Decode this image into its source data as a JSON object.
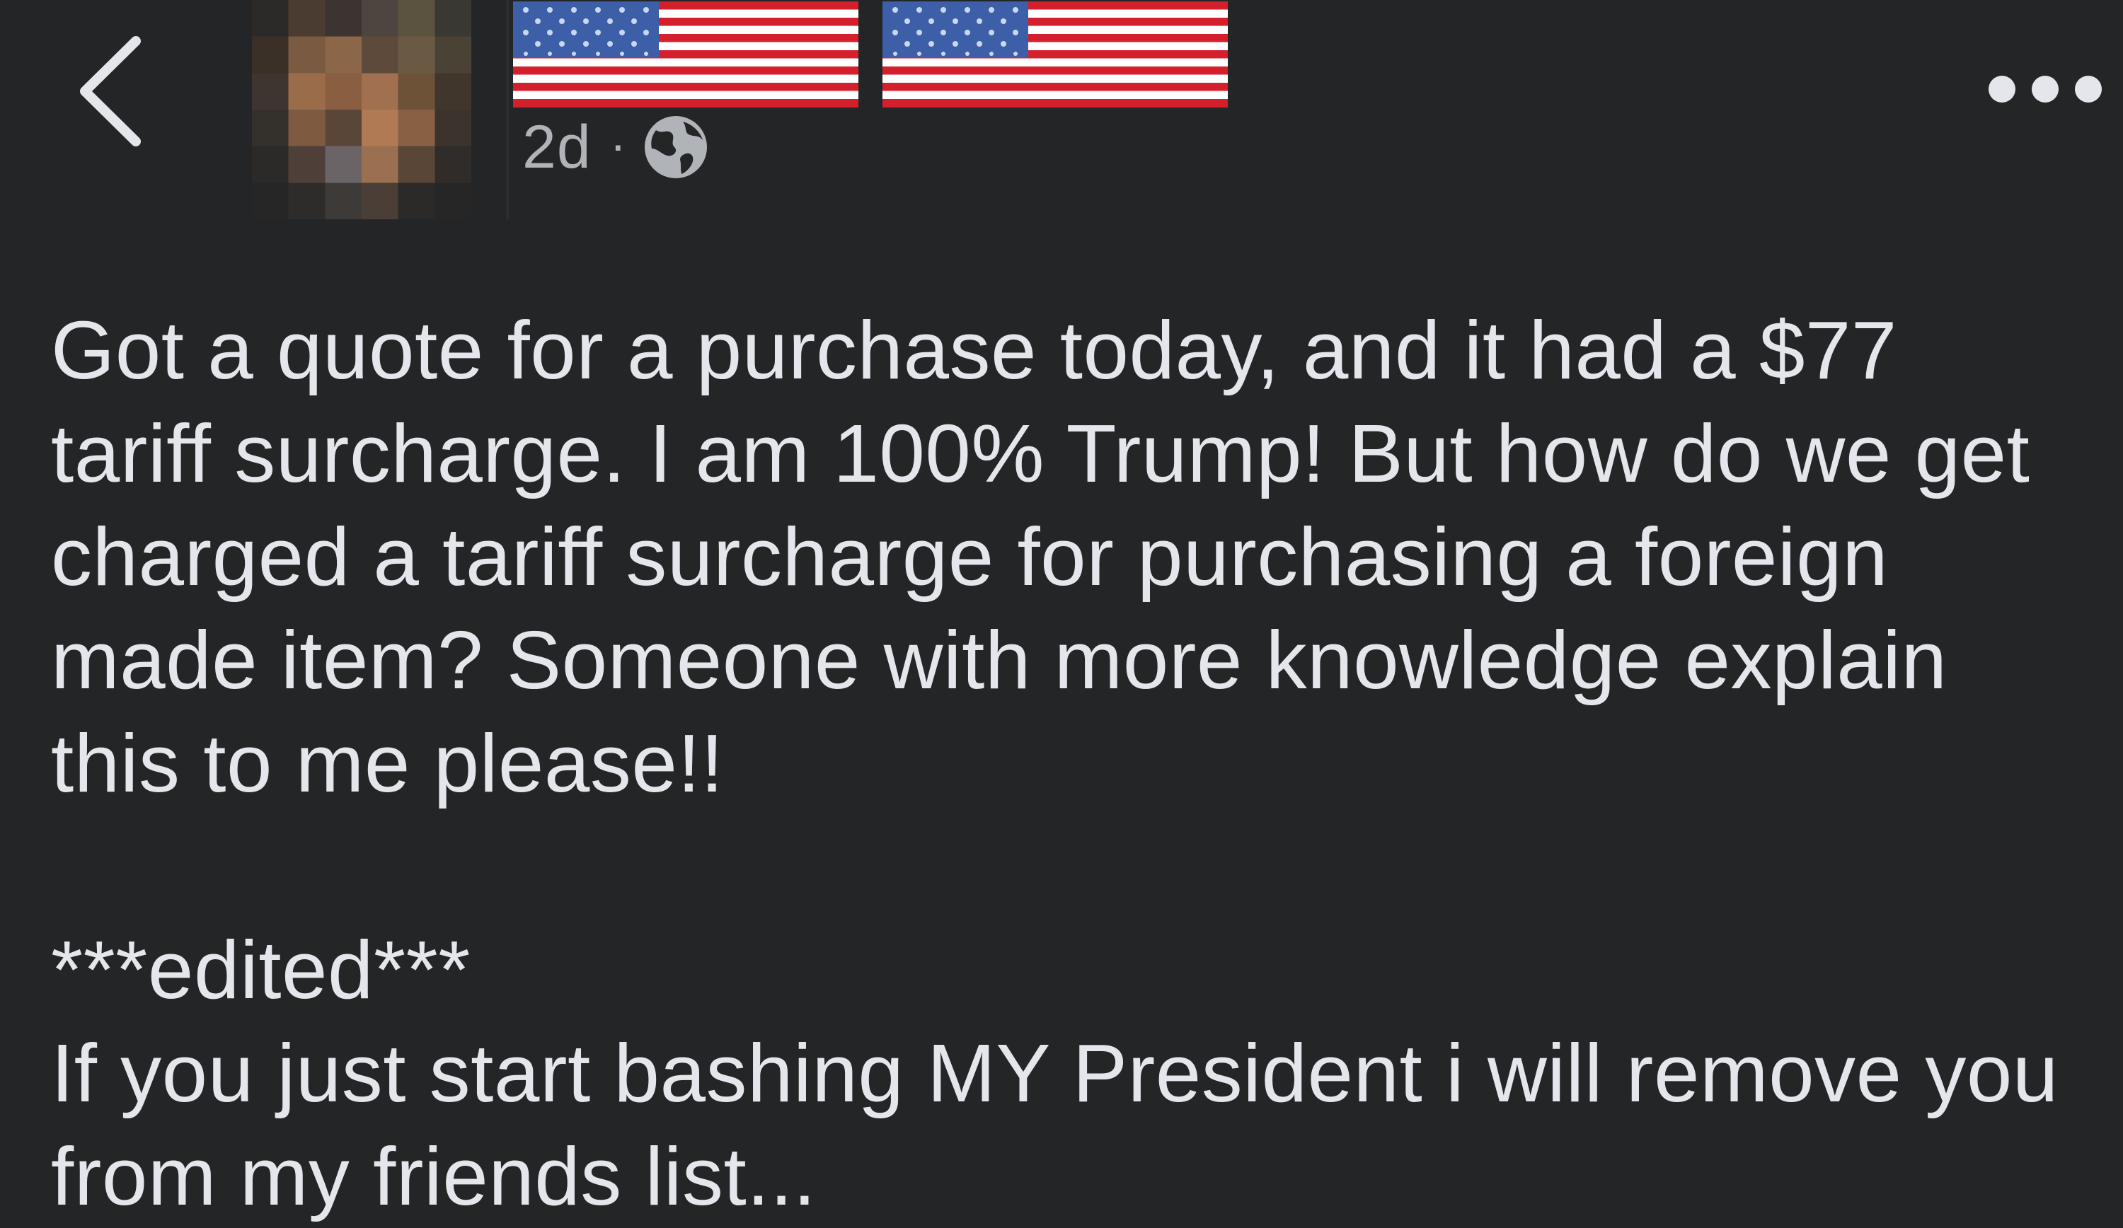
{
  "header": {
    "back_icon": "chevron-left-icon",
    "avatar_icon": "pixelated-avatar",
    "name_flags": [
      "us-flag-emoji",
      "us-flag-emoji"
    ],
    "time": "2d",
    "separator": "·",
    "audience_icon": "globe-icon",
    "more_icon": "ellipsis-icon"
  },
  "post": {
    "paragraph_1": "Got a quote for a purchase today, and it had a $77 tariff surcharge. I am 100% Trump! But how do we get charged a tariff surcharge for purchasing a foreign made item? Someone with more knowledge explain this to me please!!",
    "edited_marker": "***edited***",
    "paragraph_2": "If you just start bashing MY President i will remove you from my friends list..."
  },
  "colors": {
    "background": "#242526",
    "text_primary": "#e4e6eb",
    "text_secondary": "#b0b3b8"
  }
}
